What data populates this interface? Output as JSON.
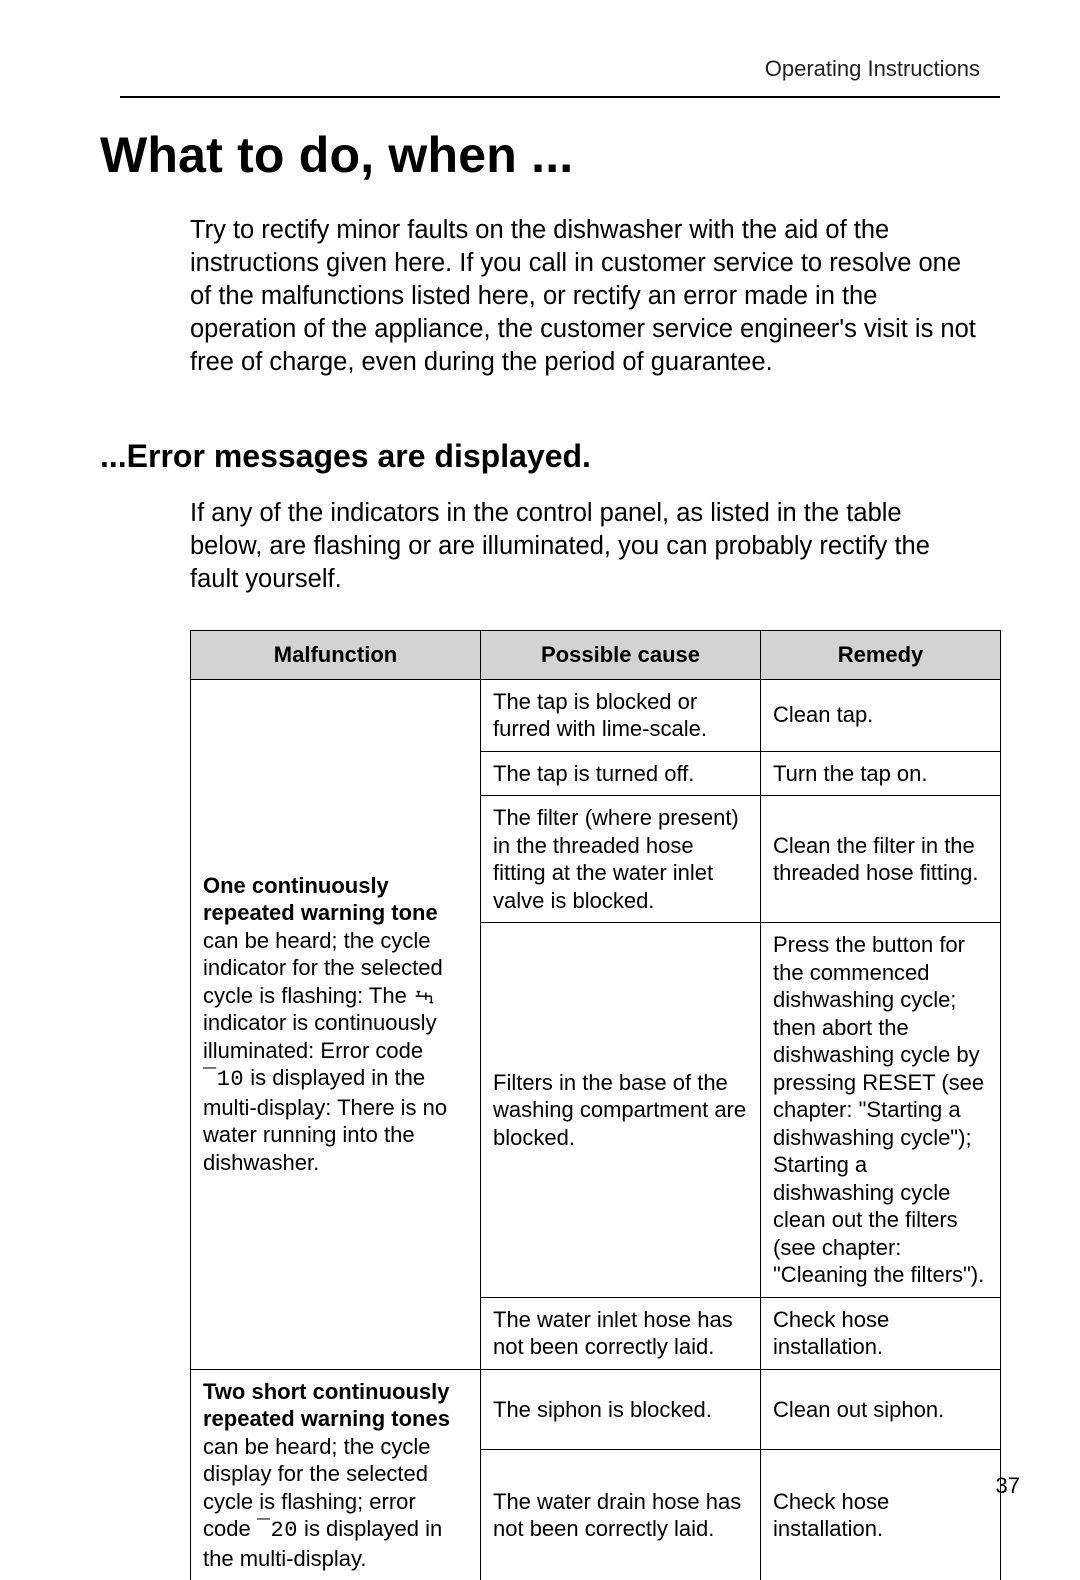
{
  "header": {
    "section": "Operating Instructions"
  },
  "title": "What to do, when ...",
  "intro": "Try to rectify minor faults on the dishwasher with the aid of the instructions given here. If you call in customer service to resolve one of the malfunctions listed here, or rectify an error made in the operation of the appliance, the customer service engineer's visit is not free of charge, even during the period of guarantee.",
  "section2": {
    "heading": "...Error messages are displayed.",
    "intro": "If any of the indicators in the control panel, as listed in the table below, are flashing or are illuminated, you can probably rectify the fault yourself."
  },
  "table": {
    "headers": {
      "col1": "Malfunction",
      "col2": "Possible cause",
      "col3": "Remedy"
    },
    "group1": {
      "malfunction_bold": "One continuously repeated warning tone",
      "malfunction_rest_a": " can be heard; the cycle indicator for the selected cycle is flashing: The ",
      "malfunction_rest_b": " indicator is continuously illuminated: Error code ",
      "malfunction_err": "¯10",
      "malfunction_rest_c": " is displayed in the multi-display: There is no water running into the dishwasher.",
      "rows": [
        {
          "cause": "The tap is blocked or furred with lime-scale.",
          "remedy": "Clean tap."
        },
        {
          "cause": "The tap is turned off.",
          "remedy": "Turn the tap on."
        },
        {
          "cause": "The filter (where present) in the threaded hose fitting at the water inlet valve is blocked.",
          "remedy": "Clean the filter in the threaded hose fitting."
        },
        {
          "cause": "Filters in the base of the washing compartment are blocked.",
          "remedy": "Press the button for the commenced dishwashing cycle; then abort the dishwashing cycle by pressing RESET (see chapter: \"Starting a dishwashing cycle\"); Starting a dishwashing cycle clean out the filters (see chapter: \"Cleaning the filters\")."
        },
        {
          "cause": "The water inlet hose has not been correctly laid.",
          "remedy": "Check hose installation."
        }
      ]
    },
    "group2": {
      "malfunction_bold": "Two short continuously repeated warning tones",
      "malfunction_rest_a": " can be heard; the cycle display for the selected cycle is flashing; error code ",
      "malfunction_err": "¯20",
      "malfunction_rest_b": " is displayed in the multi-display.",
      "rows": [
        {
          "cause": "The siphon is blocked.",
          "remedy": "Clean out siphon."
        },
        {
          "cause": "The water drain hose has not been correctly laid.",
          "remedy": "Check hose installation."
        }
      ]
    }
  },
  "page_number": "37",
  "icons": {
    "tap_icon": "tap-icon"
  }
}
